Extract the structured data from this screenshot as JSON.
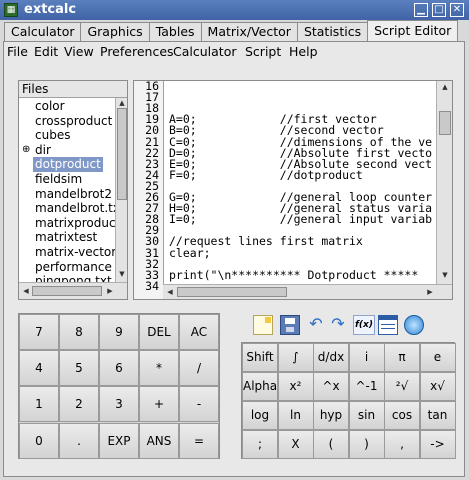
{
  "window": {
    "title": "extcalc"
  },
  "tabs": [
    "Calculator",
    "Graphics",
    "Tables",
    "Matrix/Vector",
    "Statistics",
    "Script Editor"
  ],
  "active_tab": "Script Editor",
  "menus": [
    "File",
    "Edit",
    "View",
    "Preferences",
    "Calculator",
    "Script",
    "Help"
  ],
  "files": {
    "header": "Files",
    "items": [
      "color",
      "crossproduct",
      "cubes",
      "dir",
      "dotproduct",
      "fieldsim",
      "mandelbrot2",
      "mandelbrot.txt",
      "matrixproduct",
      "matrixtest",
      "matrix-vector",
      "performance",
      "pingpong.txt"
    ],
    "selected": "dotproduct",
    "expandable": "dir"
  },
  "editor": {
    "line_numbers": [
      "16",
      "17",
      "18",
      "19",
      "20",
      "21",
      "22",
      "23",
      "24",
      "25",
      "26",
      "27",
      "28",
      "29",
      "30",
      "31",
      "32",
      "33",
      "34"
    ],
    "lines": [
      "",
      "",
      "",
      "A=0;            //first vector",
      "B=0;            //second vector",
      "C=0;            //dimensions of the ve",
      "D=0;            //Absolute first vecto",
      "E=0;            //Absolute second vect",
      "F=0;            //dotproduct",
      "",
      "G=0;            //general loop counter",
      "H=0;            //general status varia",
      "I=0;            //general input variab",
      "",
      "//request lines first matrix",
      "clear;",
      "",
      "print(\"\\n********** Dotproduct *****",
      ""
    ]
  },
  "keypad": [
    [
      "7",
      "8",
      "9",
      "DEL",
      "AC"
    ],
    [
      "4",
      "5",
      "6",
      "*",
      "/"
    ],
    [
      "1",
      "2",
      "3",
      "+",
      "-"
    ],
    [
      "0",
      ".",
      "EXP",
      "ANS",
      "="
    ]
  ],
  "toolbar": [
    "new-file-icon",
    "save-icon",
    "undo-icon",
    "redo-icon",
    "function-icon",
    "window-icon",
    "run-icon"
  ],
  "toolbar_function_label": "f(x)",
  "function_keys": [
    [
      "Shift",
      "∫",
      "d/dx",
      "i",
      "π",
      "e"
    ],
    [
      "Alpha",
      "x²",
      "^x",
      "^-1",
      "²√",
      "x√"
    ],
    [
      "log",
      "ln",
      "hyp",
      "sin",
      "cos",
      "tan"
    ],
    [
      ";",
      "X",
      "(",
      ")",
      ",",
      "->"
    ]
  ]
}
